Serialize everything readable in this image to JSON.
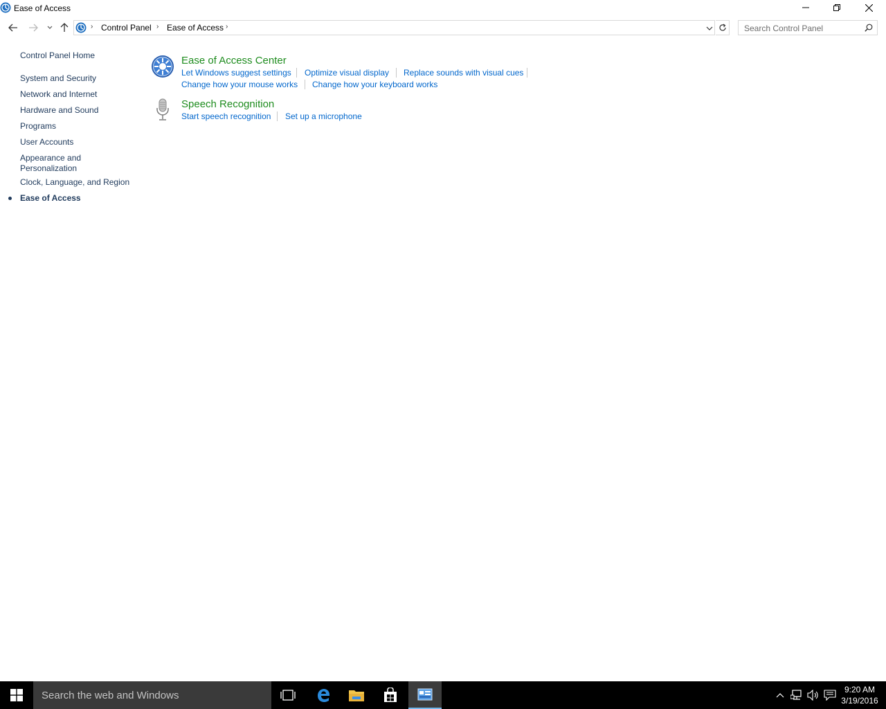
{
  "window": {
    "title": "Ease of Access"
  },
  "address_bar": {
    "breadcrumbs": [
      "Control Panel",
      "Ease of Access"
    ]
  },
  "search": {
    "placeholder": "Search Control Panel"
  },
  "sidebar": {
    "home": "Control Panel Home",
    "items": [
      {
        "label": "System and Security"
      },
      {
        "label": "Network and Internet"
      },
      {
        "label": "Hardware and Sound"
      },
      {
        "label": "Programs"
      },
      {
        "label": "User Accounts"
      },
      {
        "label": "Appearance and Personalization",
        "line1": "Appearance and",
        "line2": "Personalization"
      },
      {
        "label": "Clock, Language, and Region"
      },
      {
        "label": "Ease of Access",
        "current": true
      }
    ]
  },
  "categories": [
    {
      "title": "Ease of Access Center",
      "icon": "ease-of-access-icon",
      "tasks_row1": [
        "Let Windows suggest settings",
        "Optimize visual display",
        "Replace sounds with visual cues"
      ],
      "tasks_row2": [
        "Change how your mouse works",
        "Change how your keyboard works"
      ]
    },
    {
      "title": "Speech Recognition",
      "icon": "microphone-icon",
      "tasks_row1": [
        "Start speech recognition",
        "Set up a microphone"
      ]
    }
  ],
  "taskbar": {
    "search_placeholder": "Search the web and Windows",
    "time": "9:20 AM",
    "date": "3/19/2016"
  },
  "colors": {
    "category_title": "#1e8c1e",
    "task_link": "#0066cc",
    "sidebar_link": "#1e395b",
    "taskbar": "#000000"
  }
}
